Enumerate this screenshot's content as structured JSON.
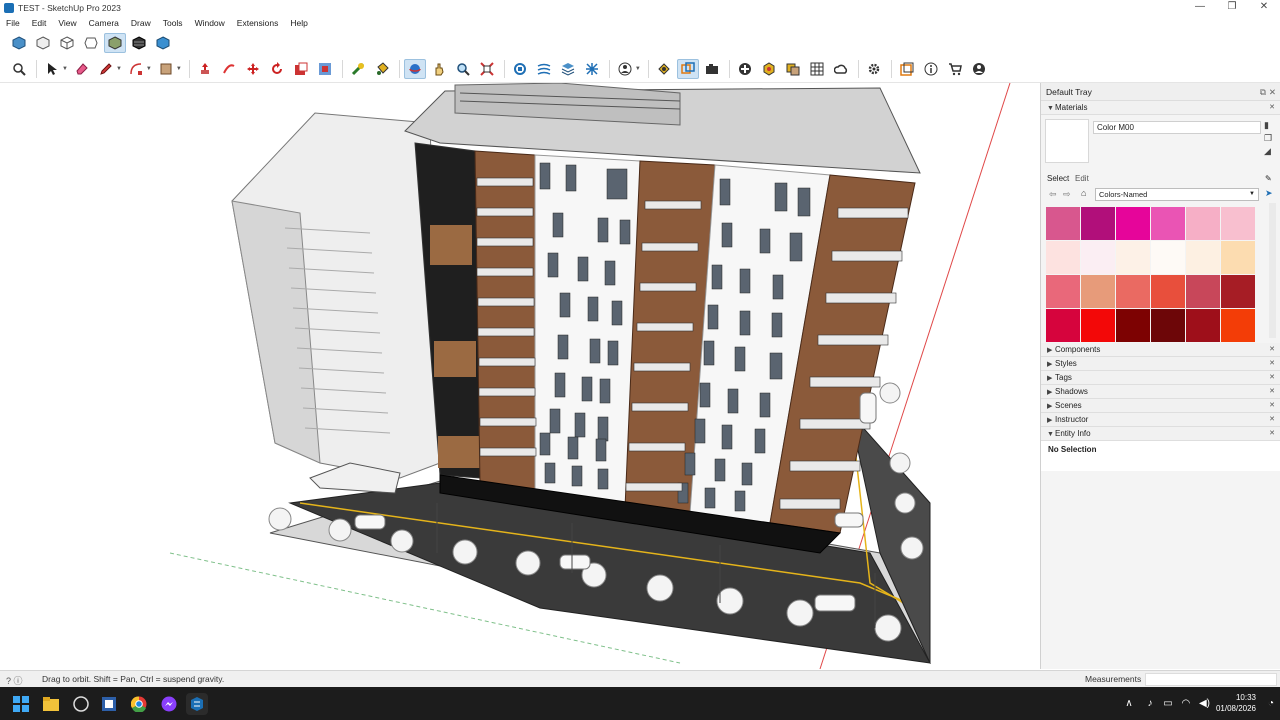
{
  "window": {
    "title": "TEST - SketchUp Pro 2023",
    "minimize": "—",
    "maximize": "❐",
    "close": "✕"
  },
  "menu": [
    "File",
    "Edit",
    "View",
    "Camera",
    "Draw",
    "Tools",
    "Window",
    "Extensions",
    "Help"
  ],
  "toolbar": {
    "views_icons": [
      "iso-view-icon",
      "top-view-icon",
      "front-view-icon",
      "right-view-icon",
      "back-view-icon",
      "left-view-icon",
      "bottom-view-icon"
    ],
    "main_icons": [
      "zoom-icon",
      "select-icon",
      "eraser-icon",
      "pencil-icon",
      "shape-icon",
      "paint-bucket-icon",
      "push-pull-icon",
      "follow-me-icon",
      "move-icon",
      "rotate-icon",
      "scale-icon",
      "offset-icon",
      "tape-measure-icon",
      "protractor-icon",
      "orbit-icon",
      "pan-icon",
      "zoom-window-icon",
      "zoom-extents-icon",
      "warehouse-icon",
      "sandbox-icon",
      "layer-icon",
      "solid-tools-icon",
      "account-icon",
      "outliner-icon",
      "section-icon",
      "camera-icon",
      "add-location-icon",
      "geo-icon",
      "photo-icon",
      "texture-icon",
      "cloud-icon",
      "settings-icon",
      "extension-icon",
      "info-icon",
      "cart-icon",
      "user-icon"
    ]
  },
  "tray": {
    "title": "Default Tray",
    "materials": {
      "section": "Materials",
      "current_name": "Color M00",
      "tab_select": "Select",
      "tab_edit": "Edit",
      "library": "Colors-Named",
      "swatches": [
        "#d8578e",
        "#b10f7a",
        "#e6059a",
        "#ea54b4",
        "#f6afc6",
        "#f8bfcf",
        "#fde2e0",
        "#fbeef3",
        "#fdf1e7",
        "#fefaf6",
        "#fdf0e2",
        "#fcdcb0",
        "#e9687a",
        "#e79b7a",
        "#ea6a62",
        "#e84f3c",
        "#c8475a",
        "#a61d25",
        "#d6043d",
        "#f30808",
        "#7d0202",
        "#6d0608",
        "#9e0f1a",
        "#f33d07"
      ]
    },
    "collapsed": [
      "Components",
      "Styles",
      "Tags",
      "Shadows",
      "Scenes",
      "Instructor"
    ],
    "entity_info": {
      "section": "Entity Info",
      "value": "No Selection"
    }
  },
  "status": {
    "hint": "Drag to orbit. Shift = Pan, Ctrl = suspend gravity.",
    "measurements_label": "Measurements"
  },
  "taskbar": {
    "time": "10:33",
    "date": "01/08/2026"
  },
  "colors": {
    "accent": "#1b6fb5",
    "facade_brown": "#8b5a3a",
    "facade_white": "#f7f7f7"
  }
}
